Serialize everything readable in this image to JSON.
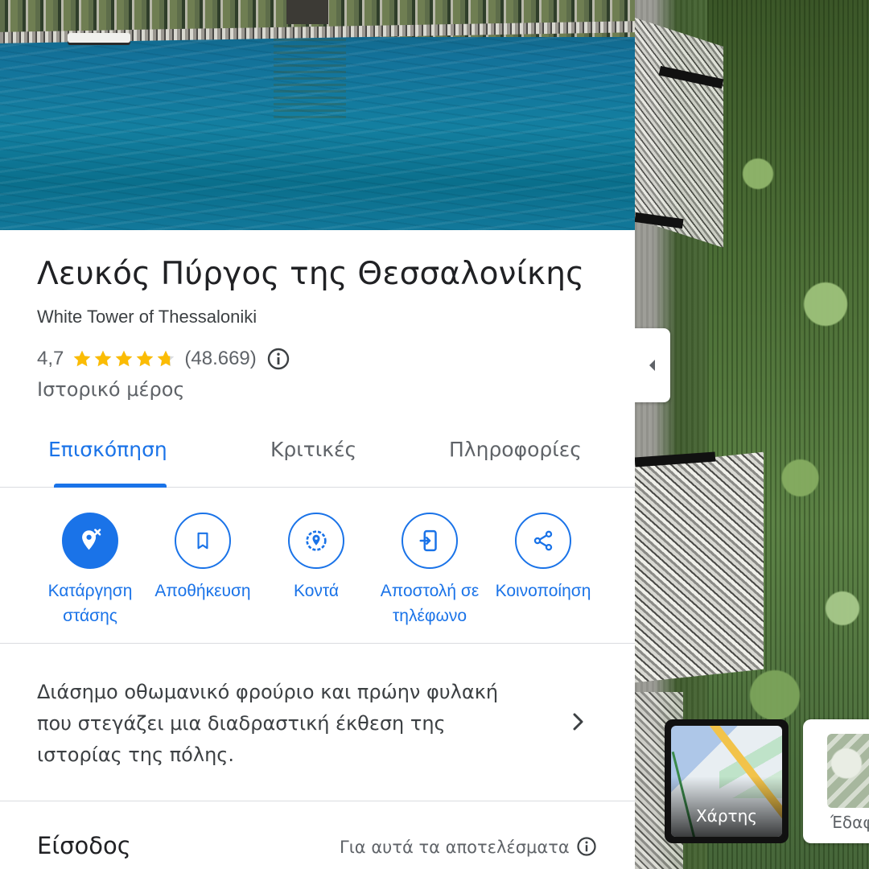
{
  "place": {
    "title": "Λευκός Πύργος της Θεσσαλονίκης",
    "subtitle": "White Tower of Thessaloniki",
    "rating": "4,7",
    "stars": 4.7,
    "review_count": "(48.669)",
    "category": "Ιστορικό μέρος"
  },
  "tabs": [
    {
      "label": "Επισκόπηση",
      "active": true
    },
    {
      "label": "Κριτικές",
      "active": false
    },
    {
      "label": "Πληροφορίες",
      "active": false
    }
  ],
  "actions": [
    {
      "label": "Κατάργηση στάσης",
      "icon": "remove-stop-icon"
    },
    {
      "label": "Αποθήκευση",
      "icon": "bookmark-icon"
    },
    {
      "label": "Κοντά",
      "icon": "nearby-icon"
    },
    {
      "label": "Αποστολή σε τηλέφωνο",
      "icon": "send-to-phone-icon"
    },
    {
      "label": "Κοινοποίηση",
      "icon": "share-icon"
    }
  ],
  "description": "Διάσημο οθωμανικό φρούριο και πρώην φυλακή που στεγάζει μια διαδραστική έκθεση της ιστορίας της πόλης.",
  "entry": {
    "title": "Είσοδος",
    "note": "Για αυτά τα αποτελέσματα"
  },
  "map_layers": {
    "map_label": "Χάρτης",
    "terrain_label": "Έδαφ"
  },
  "colors": {
    "accent": "#1a73e8",
    "star": "#fbbc04",
    "text": "#202124",
    "muted": "#5f6368"
  }
}
